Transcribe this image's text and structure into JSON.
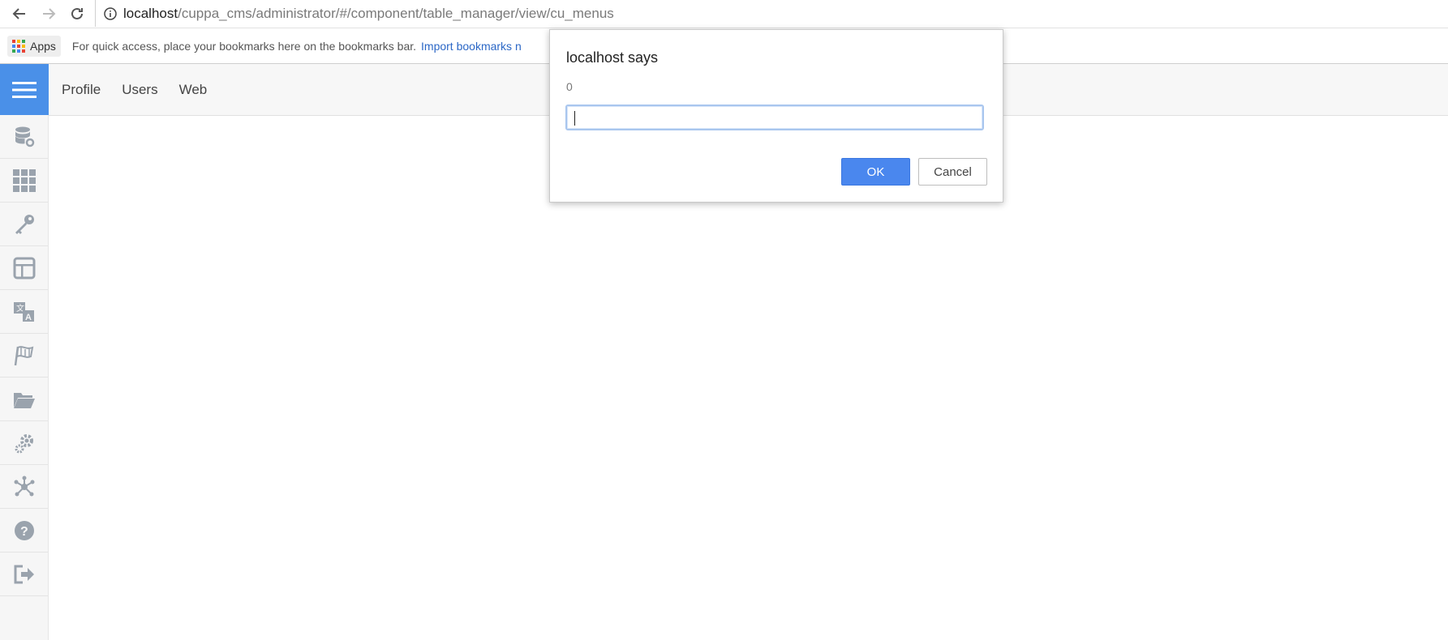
{
  "browser": {
    "url_host": "localhost",
    "url_path": "/cuppa_cms/administrator/#/component/table_manager/view/cu_menus",
    "bookmarks": {
      "apps_label": "Apps",
      "hint": "For quick access, place your bookmarks here on the bookmarks bar.",
      "import_link": "Import bookmarks n"
    }
  },
  "topnav": {
    "items": [
      "Profile",
      "Users",
      "Web"
    ]
  },
  "sidebar": {
    "icons": [
      "database-settings-icon",
      "grid-icon",
      "key-icon",
      "layout-icon",
      "translate-icon",
      "flag-icon",
      "folder-icon",
      "gears-icon",
      "network-icon",
      "help-icon",
      "logout-icon"
    ]
  },
  "dialog": {
    "title": "localhost says",
    "message": "0",
    "input_value": "",
    "ok_label": "OK",
    "cancel_label": "Cancel"
  },
  "colors": {
    "accent": "#4a90e8",
    "ok_button": "#4a87ee",
    "icon_gray": "#9aa3ad"
  }
}
